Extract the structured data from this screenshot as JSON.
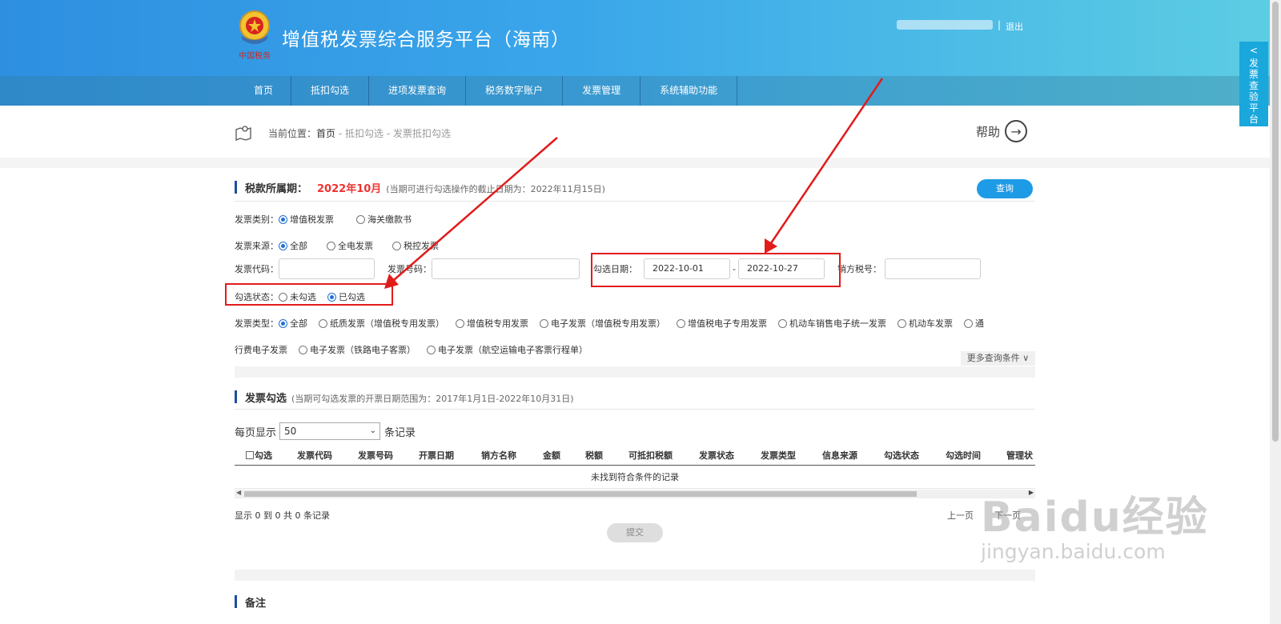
{
  "header": {
    "title": "增值税发票综合服务平台（海南）",
    "logo_text": "中国税务",
    "separator": "|",
    "logout_label": "退出"
  },
  "nav": {
    "items": [
      "首页",
      "抵扣勾选",
      "进项发票查询",
      "税务数字账户",
      "发票管理",
      "系统辅助功能"
    ]
  },
  "breadcrumb": {
    "prefix": "当前位置：",
    "home": "首页",
    "sep1": " - ",
    "level1": "抵扣勾选",
    "sep2": " - ",
    "level2": "发票抵扣勾选"
  },
  "help": {
    "label": "帮助"
  },
  "side_tab": {
    "arrow": "<",
    "label": "发票查验平台"
  },
  "period": {
    "label": "税款所属期：",
    "value": "2022年10月",
    "note": "(当期可进行勾选操作的截止日期为：2022年11月15日)",
    "query_button": "查询"
  },
  "filters": {
    "invoice_category": {
      "label": "发票类别：",
      "options": [
        "增值税发票",
        "海关缴款书"
      ],
      "selected": "增值税发票"
    },
    "invoice_source": {
      "label": "发票来源：",
      "options": [
        "全部",
        "全电发票",
        "税控发票"
      ],
      "selected": "全部"
    },
    "invoice_code": {
      "label": "发票代码：",
      "value": ""
    },
    "invoice_number": {
      "label": "发票号码：",
      "value": ""
    },
    "select_date": {
      "label": "勾选日期：",
      "from": "2022-10-01",
      "sep": "-",
      "to": "2022-10-27"
    },
    "seller_tax_id": {
      "label": "销方税号：",
      "value": ""
    },
    "select_status": {
      "label": "勾选状态：",
      "options": [
        "未勾选",
        "已勾选"
      ],
      "selected": "已勾选"
    },
    "invoice_type": {
      "label": "发票类型：",
      "options_row1": [
        "全部",
        "纸质发票（增值税专用发票）",
        "增值税专用发票",
        "电子发票（增值税专用发票）",
        "增值税电子专用发票",
        "机动车销售电子统一发票",
        "机动车发票",
        "通"
      ],
      "wrap_text": "行费电子发票",
      "options_row2": [
        "电子发票（铁路电子客票）",
        "电子发票（航空运输电子客票行程单）"
      ],
      "selected": "全部"
    },
    "more_conditions": "更多查询条件 ∨"
  },
  "invoice_select": {
    "title": "发票勾选",
    "note": "(当期可勾选发票的开票日期范围为：2017年1月1日-2022年10月31日)",
    "per_page_label": "每页显示",
    "per_page_value": "50",
    "records_suffix": "条记录",
    "columns": [
      "勾选",
      "发票代码",
      "发票号码",
      "开票日期",
      "销方名称",
      "金额",
      "税额",
      "可抵扣税额",
      "发票状态",
      "发票类型",
      "信息来源",
      "勾选状态",
      "勾选时间",
      "管理状"
    ],
    "empty_text": "未找到符合条件的记录",
    "summary": "显示 0 到 0 共 0 条记录",
    "prev": "上一页",
    "next": "下一页",
    "submit": "提交"
  },
  "remarks": {
    "title": "备注"
  },
  "watermark": {
    "brand": "Baidu经验",
    "url": "jingyan.baidu.com"
  },
  "colors": {
    "accent": "#1e9be6",
    "highlight": "#e21b1b",
    "header_start": "#2e8fe0",
    "header_end": "#5ccde3"
  }
}
